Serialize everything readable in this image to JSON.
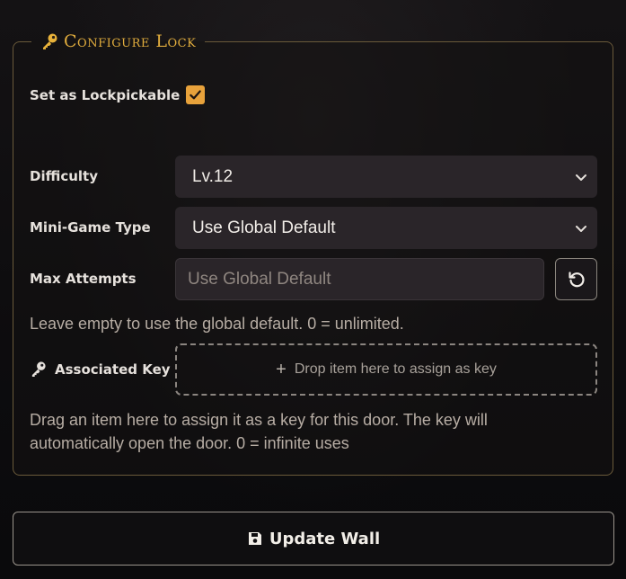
{
  "panel": {
    "title": "Configure Lock",
    "lockpickable_label": "Set as Lockpickable",
    "lockpickable_checked": true,
    "difficulty_label": "Difficulty",
    "difficulty_value": "Lv.12",
    "minigame_label": "Mini-Game Type",
    "minigame_value": "Use Global Default",
    "max_attempts_label": "Max Attempts",
    "max_attempts_value": "",
    "max_attempts_placeholder": "Use Global Default",
    "max_attempts_hint": "Leave empty to use the global default. 0 = unlimited.",
    "associated_key_label": "Associated Key",
    "dropzone_text": "Drop item here to assign as key",
    "associated_key_hint_line1": "Drag an item here to assign it as a key for this door. The key will",
    "associated_key_hint_line2": "automatically open the door. 0 = infinite uses"
  },
  "footer": {
    "update_label": "Update Wall"
  },
  "icons": {
    "title": "key-icon",
    "checkbox": "checkmark-icon",
    "select": "chevron-down-icon",
    "reset": "reset-icon",
    "associated_key": "key-icon",
    "dropzone": "plus-icon",
    "update": "save-icon"
  },
  "colors": {
    "accent": "#e0ac3d",
    "checkbox": "#e8a23b",
    "field_bg": "#2a2529",
    "border": "#6a5a3a",
    "text": "#e6e1dc"
  }
}
